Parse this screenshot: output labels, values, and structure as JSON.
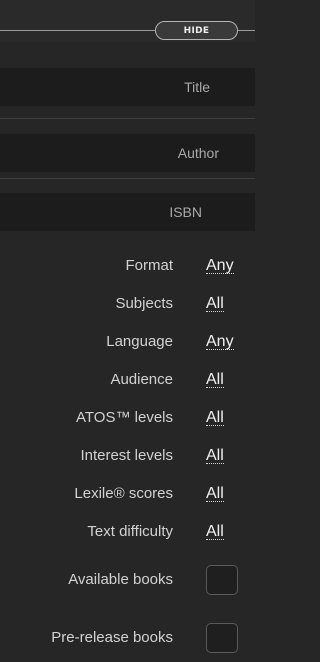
{
  "hide_button": {
    "label": "HIDE"
  },
  "search_fields": {
    "title": {
      "placeholder": "Title"
    },
    "author": {
      "placeholder": "Author"
    },
    "isbn": {
      "placeholder": "ISBN"
    }
  },
  "filters": [
    {
      "label": "Format",
      "value": "Any"
    },
    {
      "label": "Subjects",
      "value": "All"
    },
    {
      "label": "Language",
      "value": "Any"
    },
    {
      "label": "Audience",
      "value": "All"
    },
    {
      "label": "ATOS™ levels",
      "value": "All"
    },
    {
      "label": "Interest levels",
      "value": "All"
    },
    {
      "label": "Lexile® scores",
      "value": "All"
    },
    {
      "label": "Text difficulty",
      "value": "All"
    }
  ],
  "checkboxes": [
    {
      "label": "Available books",
      "checked": false
    },
    {
      "label": "Pre-release books",
      "checked": false
    }
  ]
}
